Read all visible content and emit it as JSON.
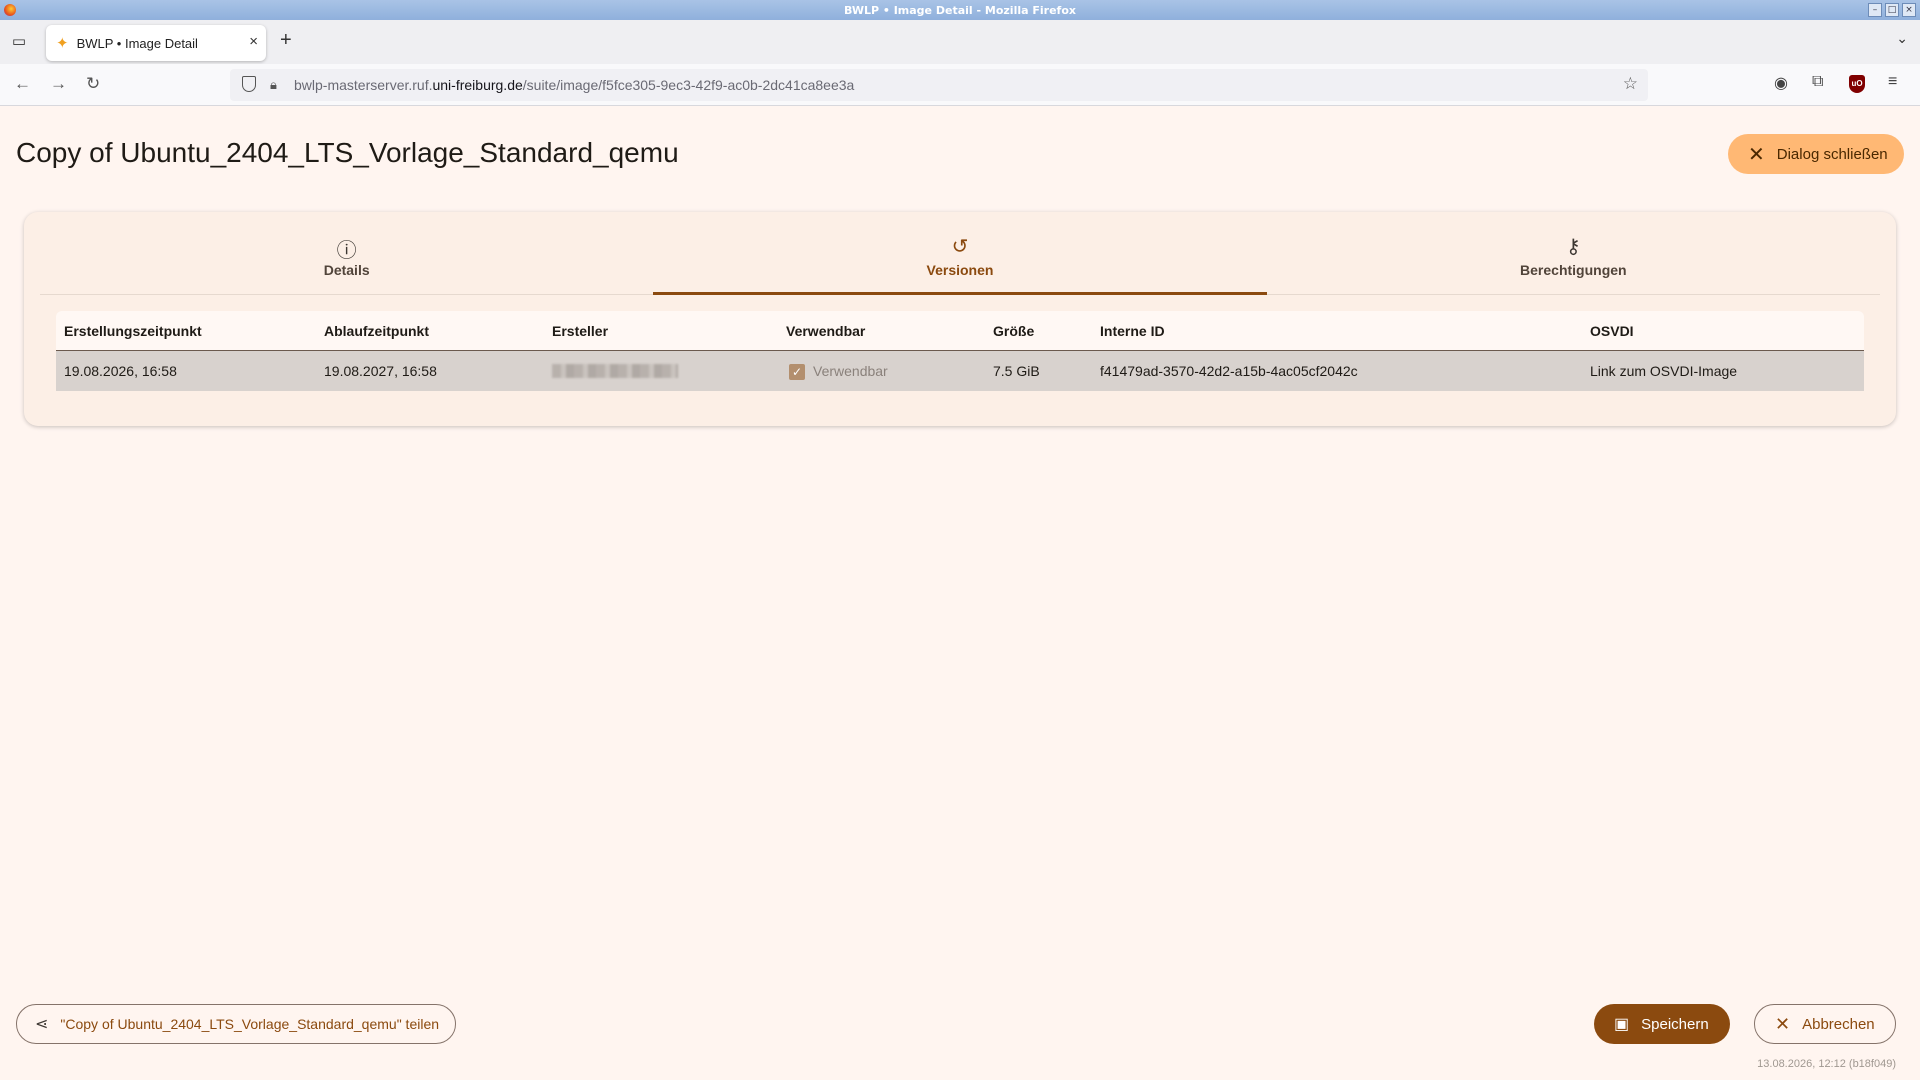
{
  "window": {
    "title": "BWLP • Image Detail - Mozilla Firefox"
  },
  "browser": {
    "tab_title": "BWLP • Image Detail",
    "url_prefix": "bwlp-masterserver.ruf.",
    "url_domain": "uni-freiburg.de",
    "url_path": "/suite/image/f5fce305-9ec3-42f9-ac0b-2dc41ca8ee3a"
  },
  "page": {
    "title": "Copy of Ubuntu_2404_LTS_Vorlage_Standard_qemu",
    "close_dialog_label": "Dialog schließen"
  },
  "tabs": [
    {
      "label": "Details",
      "icon": "info-icon"
    },
    {
      "label": "Versionen",
      "icon": "history-icon"
    },
    {
      "label": "Berechtigungen",
      "icon": "key-icon"
    }
  ],
  "table": {
    "headers": [
      "Erstellungszeitpunkt",
      "Ablaufzeitpunkt",
      "Ersteller",
      "Verwendbar",
      "Größe",
      "Interne ID",
      "OSVDI"
    ],
    "rows": [
      {
        "created": "19.08.2026, 16:58",
        "expires": "19.08.2027, 16:58",
        "creator": "",
        "usable": "Verwendbar",
        "size": "7.5 GiB",
        "internal_id": "f41479ad-3570-42d2-a15b-4ac05cf2042c",
        "osvdi": "Link zum OSVDI-Image"
      }
    ]
  },
  "actions": {
    "share_label": "\"Copy of Ubuntu_2404_LTS_Vorlage_Standard_qemu\" teilen",
    "save_label": "Speichern",
    "cancel_label": "Abbrechen"
  },
  "footer": {
    "timestamp": "13.08.2026, 12:12 (b18f049)"
  },
  "colors": {
    "primary": "#8b4a0f",
    "accent": "#ffb874",
    "background": "#fff5f0"
  }
}
